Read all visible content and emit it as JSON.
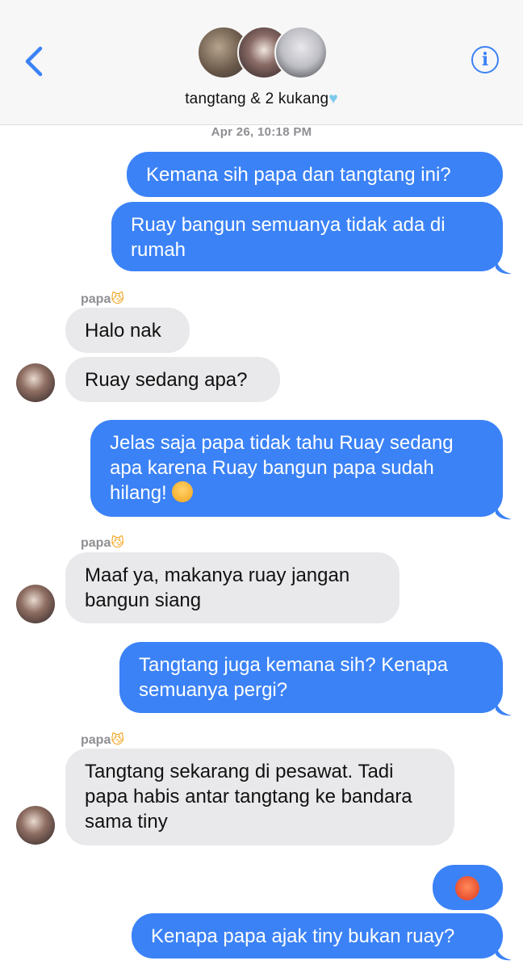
{
  "header": {
    "group_name": "tangtang & 2 kukang",
    "heart_icon": "light-blue-heart-emoji",
    "info_label": "i"
  },
  "timestamp": "Apr 26, 10:18 PM",
  "messages": [
    {
      "direction": "outgoing",
      "text": "Kemana sih papa dan tangtang ini?"
    },
    {
      "direction": "outgoing",
      "text": "Ruay bangun semuanya tidak ada di rumah"
    },
    {
      "direction": "incoming",
      "sender": "papa",
      "text": "Halo nak"
    },
    {
      "direction": "incoming",
      "text": "Ruay sedang apa?"
    },
    {
      "direction": "outgoing",
      "text": "Jelas saja papa tidak tahu Ruay sedang apa karena Ruay bangun papa sudah hilang!",
      "emoji": "angry-face-emoji"
    },
    {
      "direction": "incoming",
      "sender": "papa",
      "text": "Maaf ya, makanya ruay jangan bangun siang"
    },
    {
      "direction": "outgoing",
      "text": "Tangtang juga kemana sih? Kenapa semuanya pergi?"
    },
    {
      "direction": "incoming",
      "sender": "papa",
      "text": "Tangtang sekarang di pesawat. Tadi papa habis antar tangtang ke bandara sama tiny"
    },
    {
      "direction": "outgoing",
      "emoji": "pouting-face-emoji"
    },
    {
      "direction": "outgoing",
      "text": "Kenapa papa ajak tiny bukan ruay?"
    }
  ],
  "colors": {
    "outgoing_bubble": "#3b82f6",
    "incoming_bubble": "#e9e9eb",
    "accent": "#3b82f6"
  }
}
